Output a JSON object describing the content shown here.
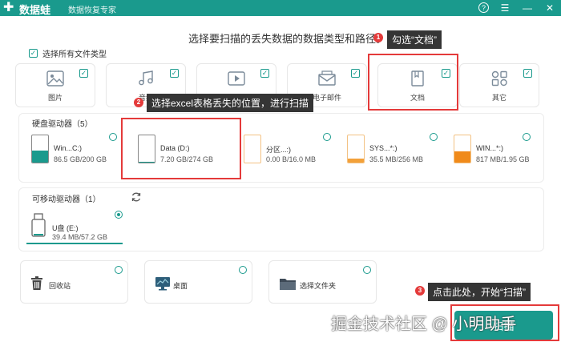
{
  "app": {
    "name": "数据蛙",
    "subtitle": "数据恢复专家"
  },
  "prompt": "选择要扫描的丢失数据的数据类型和路径。",
  "select_all_label": "选择所有文件类型",
  "file_types": [
    {
      "label": "图片",
      "icon": "image-icon"
    },
    {
      "label": "音频",
      "icon": "music-icon"
    },
    {
      "label": "视频",
      "icon": "video-icon"
    },
    {
      "label": "电子邮件",
      "icon": "email-icon"
    },
    {
      "label": "文档",
      "icon": "document-icon"
    },
    {
      "label": "其它",
      "icon": "other-icon"
    }
  ],
  "hard_drives": {
    "title": "硬盘驱动器（5）",
    "items": [
      {
        "name": "Win...C:)",
        "size": "86.5 GB/200 GB",
        "fill": 0.43,
        "color": "#1a9a8d"
      },
      {
        "name": "Data (D:)",
        "size": "7.20 GB/274 GB",
        "fill": 0.03,
        "color": "#1a9a8d"
      },
      {
        "name": "分区...:)",
        "size": "0.00  B/16.0 MB",
        "fill": 0.0,
        "color": "#f3a13a"
      },
      {
        "name": "SYS...*:)",
        "size": "35.5 MB/256 MB",
        "fill": 0.14,
        "color": "#f3a13a"
      },
      {
        "name": "WIN...*:)",
        "size": "817 MB/1.95 GB",
        "fill": 0.42,
        "color": "#f08a1a"
      }
    ]
  },
  "removable": {
    "title": "可移动驱动器（1）",
    "items": [
      {
        "name": "U盘 (E:)",
        "size": "39.4 MB/57.2 GB",
        "fill": 0.001
      }
    ]
  },
  "quick_locations": [
    {
      "label": "回收站",
      "icon": "recycle-bin-icon"
    },
    {
      "label": "桌面",
      "icon": "desktop-icon"
    },
    {
      "label": "选择文件夹",
      "icon": "folder-icon"
    }
  ],
  "annotations": {
    "step1": {
      "num": "1",
      "text": "勾选“文档”"
    },
    "step2": {
      "num": "2",
      "text": "选择excel表格丢失的位置，进行扫描"
    },
    "step3": {
      "num": "3",
      "text": "点击此处，开始“扫描”"
    }
  },
  "scan_button": "扫描",
  "watermark": "掘金技术社区 @ 小明助手",
  "colors": {
    "accent": "#1a9a8d",
    "annotation": "#e43a3a",
    "callout": "#353535"
  }
}
